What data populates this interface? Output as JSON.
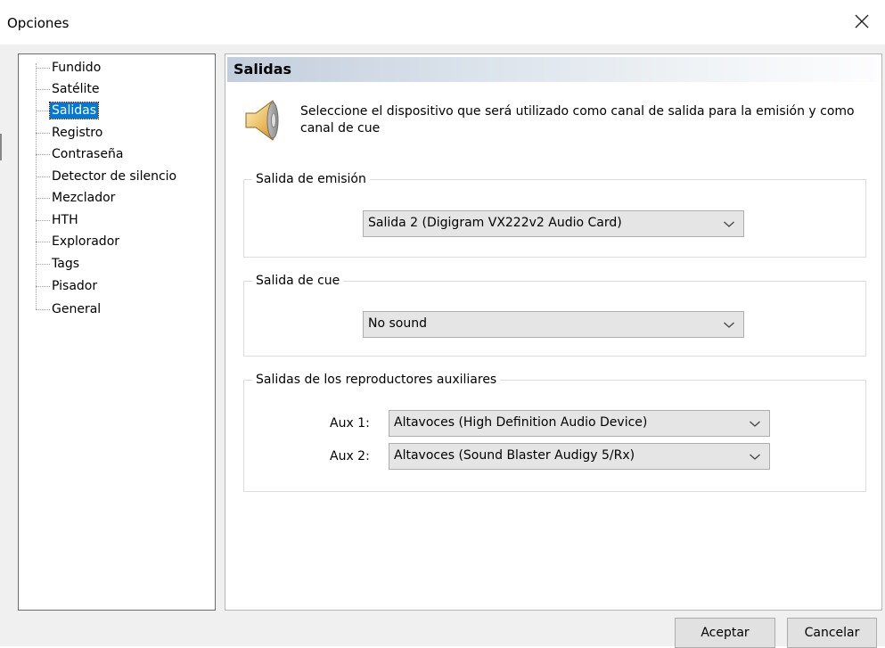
{
  "window": {
    "title": "Opciones",
    "close_icon": "close-icon"
  },
  "tree": {
    "items": [
      {
        "label": "Fundido",
        "selected": false
      },
      {
        "label": "Satélite",
        "selected": false
      },
      {
        "label": "Salidas",
        "selected": true
      },
      {
        "label": "Registro",
        "selected": false
      },
      {
        "label": "Contraseña",
        "selected": false
      },
      {
        "label": "Detector de silencio",
        "selected": false
      },
      {
        "label": "Mezclador",
        "selected": false
      },
      {
        "label": "HTH",
        "selected": false
      },
      {
        "label": "Explorador",
        "selected": false
      },
      {
        "label": "Tags",
        "selected": false
      },
      {
        "label": "Pisador",
        "selected": false
      },
      {
        "label": "General",
        "selected": false
      }
    ]
  },
  "panel": {
    "title": "Salidas",
    "icon": "speaker-icon",
    "description": "Seleccione el dispositivo que será utilizado como canal de salida para la emisión y como canal de cue"
  },
  "broadcast_output": {
    "label": "Salida de emisión",
    "value": "Salida 2 (Digigram VX222v2 Audio Card)"
  },
  "cue_output": {
    "label": "Salida de cue",
    "value": "No sound"
  },
  "aux_outputs": {
    "label": "Salidas de los reproductores auxiliares",
    "aux1": {
      "label": "Aux 1:",
      "value": "Altavoces (High Definition Audio Device)"
    },
    "aux2": {
      "label": "Aux 2:",
      "value": "Altavoces (Sound Blaster Audigy 5/Rx)"
    }
  },
  "buttons": {
    "ok": "Aceptar",
    "cancel": "Cancelar"
  },
  "colors": {
    "selection": "#0078d7",
    "header_gradient_start": "#c2cedd",
    "dialog_background": "#f0f0f0"
  }
}
